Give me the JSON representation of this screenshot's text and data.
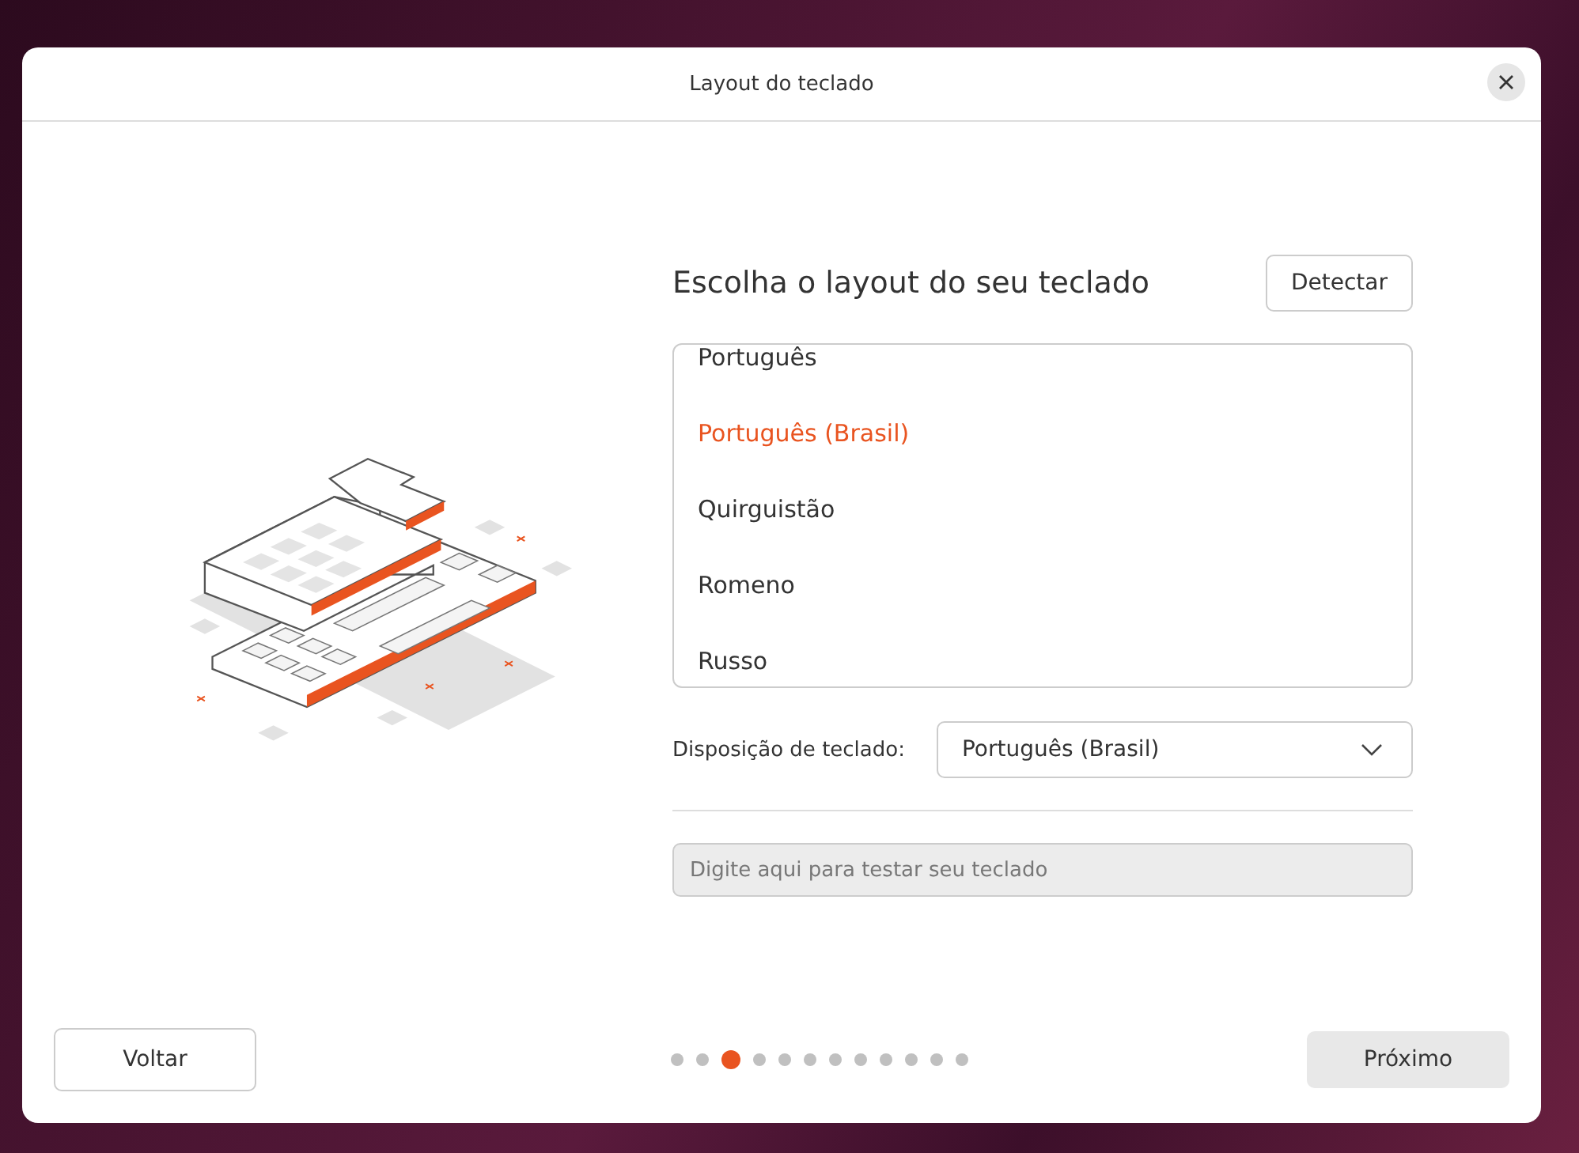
{
  "window": {
    "title": "Layout do teclado"
  },
  "heading": "Escolha o layout do seu teclado",
  "detect_button": "Detectar",
  "layouts": [
    {
      "label": "Português",
      "selected": false
    },
    {
      "label": "Português (Brasil)",
      "selected": true
    },
    {
      "label": "Quirguistão",
      "selected": false
    },
    {
      "label": "Romeno",
      "selected": false
    },
    {
      "label": "Russo",
      "selected": false
    }
  ],
  "variant": {
    "label": "Disposição de teclado:",
    "value": "Português (Brasil)"
  },
  "test_field": {
    "placeholder": "Digite aqui para testar seu teclado"
  },
  "back_button": "Voltar",
  "next_button": "Próximo",
  "steps": [
    {
      "selected": false
    },
    {
      "selected": false
    },
    {
      "selected": true
    },
    {
      "selected": false
    },
    {
      "selected": false
    },
    {
      "selected": false
    },
    {
      "selected": false
    },
    {
      "selected": false
    },
    {
      "selected": false
    },
    {
      "selected": false
    },
    {
      "selected": false
    },
    {
      "selected": false
    }
  ]
}
